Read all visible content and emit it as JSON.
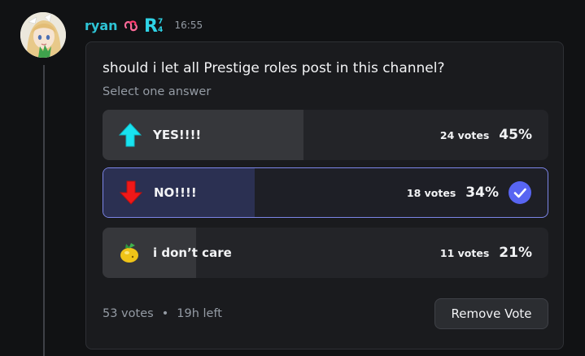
{
  "message": {
    "username": "ryan",
    "timestamp": "16:55",
    "username_color": "#2ec4d6",
    "badge_icons": [
      "pink-knot-icon",
      "cyan-r-badge-icon"
    ]
  },
  "poll": {
    "question": "should i let all Prestige roles post in this channel?",
    "subtitle": "Select one answer",
    "answers": [
      {
        "label": "YES!!!!",
        "emoji": "up-arrow-emoji",
        "votes": "24 votes",
        "percent": "45%",
        "share": 0.45,
        "selected": false
      },
      {
        "label": "NO!!!!",
        "emoji": "down-arrow-emoji",
        "votes": "18 votes",
        "percent": "34%",
        "share": 0.34,
        "selected": true
      },
      {
        "label": "i don’t care",
        "emoji": "tangerine-emoji",
        "votes": "11 votes",
        "percent": "21%",
        "share": 0.21,
        "selected": false
      }
    ],
    "total_votes": "53 votes",
    "separator": "•",
    "time_left": "19h left",
    "remove_vote_label": "Remove Vote",
    "accent_color": "#5865f2"
  }
}
